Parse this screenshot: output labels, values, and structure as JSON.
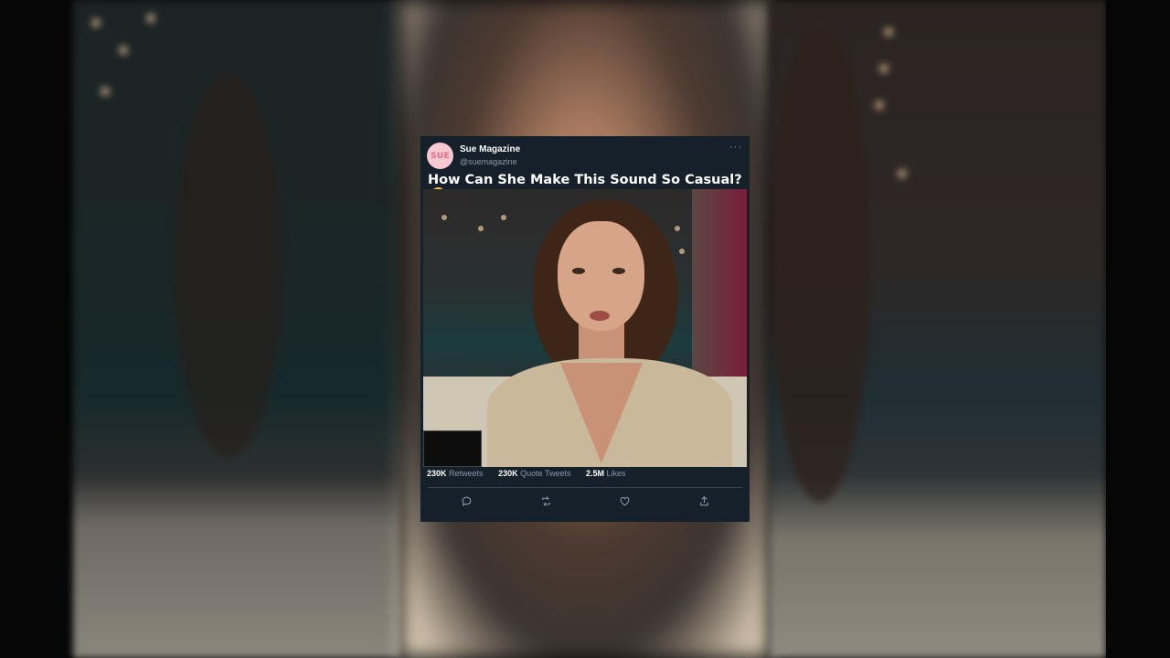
{
  "tweet": {
    "account_name": "Sue Magazine",
    "handle": "@suemagazine",
    "avatar_text": "SUE",
    "more_label": "···",
    "headline": "How Can She Make This Sound So Casual?",
    "headline_emoji": "flushed-face-emoji",
    "stats": {
      "retweets_count": "230K",
      "retweets_label": "Retweets",
      "quotes_count": "230K",
      "quotes_label": "Quote Tweets",
      "likes_count": "2.5M",
      "likes_label": "Likes"
    },
    "actions": [
      "reply-icon",
      "retweet-icon",
      "like-icon",
      "share-icon"
    ]
  },
  "colors": {
    "card_bg": "#15202b",
    "muted_text": "#8899a6",
    "divider": "#38444d",
    "avatar_bg": "#f6c8cf",
    "avatar_text": "#e46b86"
  }
}
